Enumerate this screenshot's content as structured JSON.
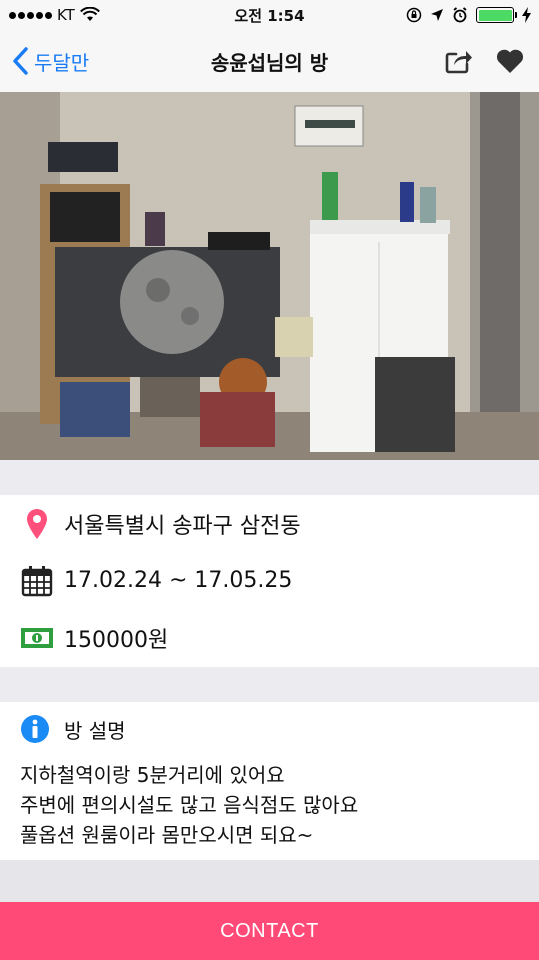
{
  "status_bar": {
    "carrier": "KT",
    "time": "오전 1:54"
  },
  "nav": {
    "back_label": "두달만",
    "title": "송윤섭님의 방"
  },
  "photo": {
    "description_icon": "room-photo"
  },
  "details": {
    "location": "서울특별시 송파구 삼전동",
    "period": "17.02.24 ~ 17.05.25",
    "price": "150000원"
  },
  "description": {
    "heading": "방 설명",
    "lines": [
      "지하철역이랑 5분거리에 있어요",
      "주변에 편의시설도 많고 음식점도 많아요",
      "풀옵션 원룸이라 몸만오시면 되요~"
    ]
  },
  "contact": {
    "label": "CONTACT"
  },
  "colors": {
    "accent": "#1a7cf5",
    "contact": "#ff4a78",
    "pin": "#ff4f7b",
    "info": "#1a8af5",
    "money": "#2e9e3e"
  }
}
